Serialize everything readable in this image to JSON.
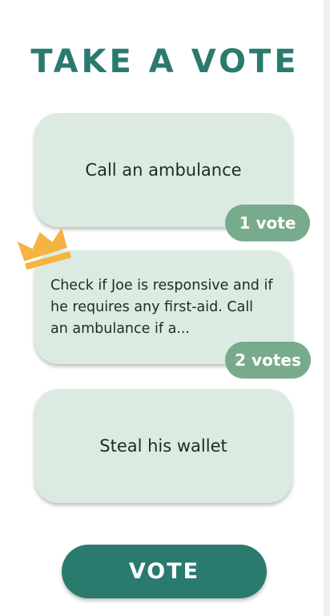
{
  "header": {
    "title": "TAKE A VOTE"
  },
  "options": [
    {
      "text": "Call an ambulance",
      "votes": "1 vote"
    },
    {
      "text": "Check if Joe is responsive and if he requires any first-aid. Call an ambulance if a...",
      "votes": "2 votes",
      "leading": true
    },
    {
      "text": "Steal his wallet"
    }
  ],
  "actions": {
    "vote_label": "VOTE"
  },
  "colors": {
    "primary": "#2b7a6e",
    "card_bg": "#dcebe2",
    "badge_bg": "#78ab8b",
    "crown": "#f5b342"
  },
  "icons": {
    "leader": "crown-icon"
  }
}
